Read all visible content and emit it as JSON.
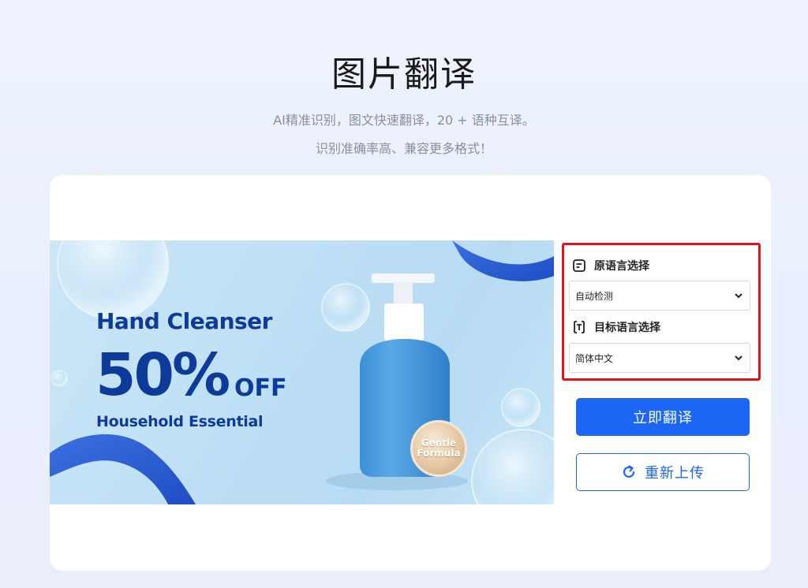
{
  "header": {
    "title": "图片翻译",
    "subtitle_line1": "AI精准识别，图文快速翻译，20 + 语种互译。",
    "subtitle_line2": "识别准确率高、兼容更多格式！"
  },
  "preview": {
    "headline": "Hand Cleanser",
    "discount": "50%",
    "off": "OFF",
    "tagline": "Household Essential",
    "badge_line1": "Gentle",
    "badge_line2": "Formula"
  },
  "language": {
    "source_label": "原语言选择",
    "source_value": "自动检测",
    "target_label": "目标语言选择",
    "target_value": "简体中文"
  },
  "actions": {
    "translate_label": "立即翻译",
    "reupload_label": "重新上传"
  },
  "colors": {
    "accent": "#1b66f5",
    "highlight_border": "#e8121a",
    "banner_text": "#0e3a9a"
  },
  "icons": {
    "source": "document-icon",
    "target": "translate-icon",
    "select": "chevron-down-icon",
    "reupload": "refresh-icon"
  }
}
